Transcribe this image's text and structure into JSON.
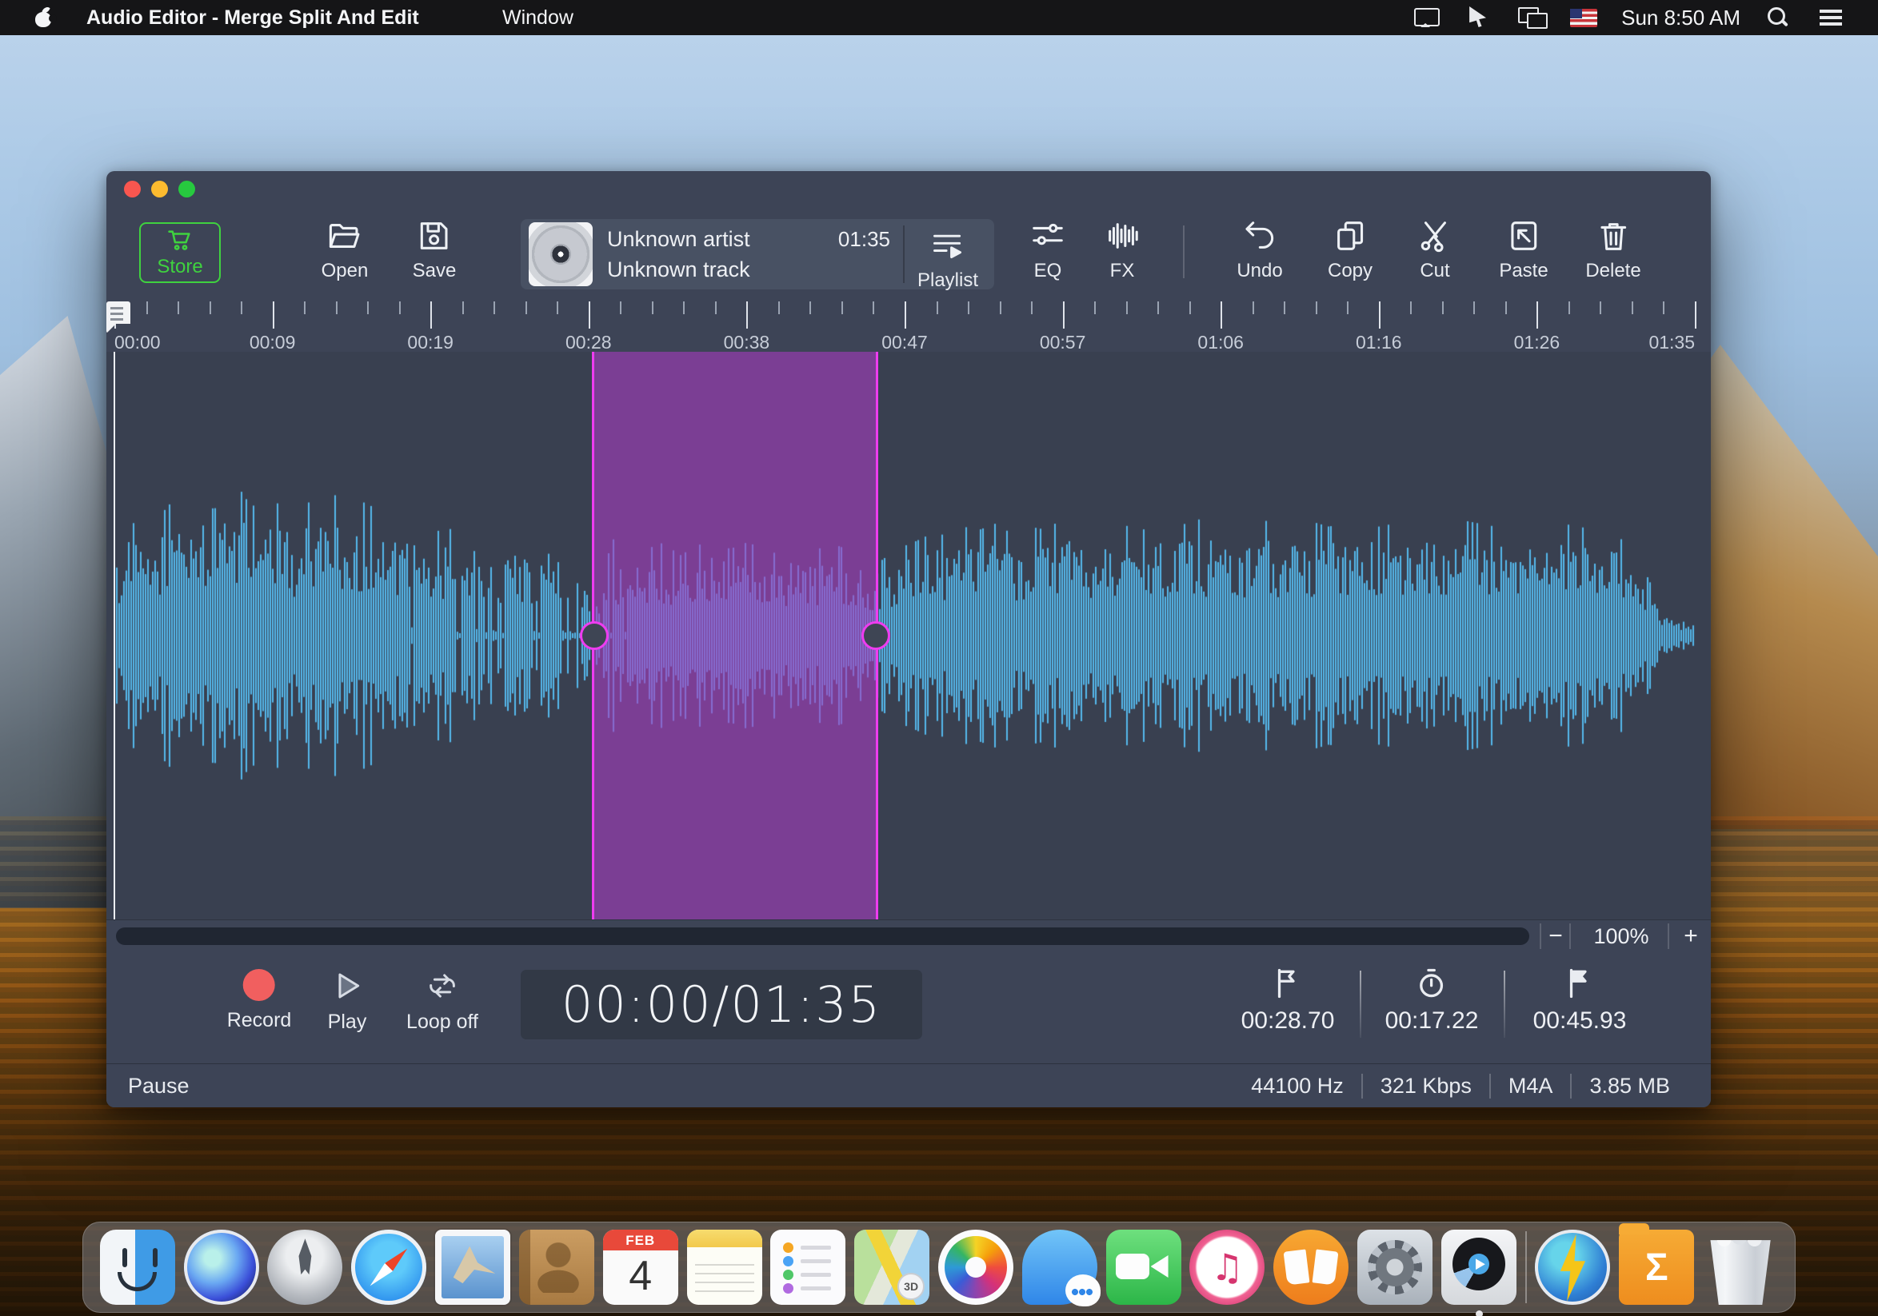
{
  "menu_bar": {
    "app_name": "Audio Editor - Merge Split And Edit",
    "menu": "Window",
    "clock": "Sun 8:50 AM"
  },
  "window": {
    "toolbar": {
      "store": "Store",
      "open": "Open",
      "save": "Save",
      "playlist": "Playlist",
      "eq": "EQ",
      "fx": "FX",
      "undo": "Undo",
      "copy": "Copy",
      "cut": "Cut",
      "paste": "Paste",
      "delete": "Delete"
    },
    "track": {
      "artist": "Unknown artist",
      "title": "Unknown track",
      "duration": "01:35"
    },
    "timeline": {
      "total_seconds": 95,
      "labels": [
        "00:00",
        "00:09",
        "00:19",
        "00:28",
        "00:38",
        "00:47",
        "00:57",
        "01:06",
        "01:16",
        "01:26",
        "01:35"
      ]
    },
    "waveform": {
      "color": "#55b8ec",
      "sparse_region": [
        17,
        31
      ],
      "envelope": [
        0.5,
        0.72,
        0.6,
        0.78,
        0.9,
        0.82,
        0.95,
        1.0,
        0.84,
        0.76,
        0.84,
        0.68,
        0.9,
        0.94,
        0.7,
        0.83,
        0.78,
        0.68,
        0.74,
        0.63,
        0.68,
        0.6,
        0.73,
        0.58,
        0.66,
        0.56,
        0.5,
        0.6,
        0.46,
        0.3,
        0.6,
        0.48,
        0.54,
        0.58,
        0.5,
        0.56,
        0.6,
        0.54,
        0.58,
        0.55,
        0.5,
        0.56,
        0.52,
        0.58,
        0.54,
        0.48,
        0.46,
        0.54,
        0.58,
        0.63,
        0.63,
        0.68,
        0.66,
        0.7,
        0.63,
        0.68,
        0.66,
        0.73,
        0.7,
        0.68,
        0.71,
        0.68,
        0.66,
        0.7,
        0.68,
        0.73,
        0.7,
        0.68,
        0.66,
        0.72,
        0.7,
        0.68,
        0.71,
        0.68,
        0.7,
        0.72,
        0.68,
        0.7,
        0.66,
        0.7,
        0.68,
        0.72,
        0.7,
        0.68,
        0.7,
        0.66,
        0.68,
        0.7,
        0.68,
        0.66,
        0.63,
        0.58,
        0.4,
        0.18,
        0.1,
        0.06
      ]
    },
    "selection": {
      "start_seconds": 28.7,
      "end_seconds": 45.93,
      "start_label": "00:28.70",
      "length_label": "00:17.22",
      "end_label": "00:45.93",
      "overlay_color": "rgba(165,62,190,0.62)",
      "border_color": "#ee3cf0"
    },
    "zoom": {
      "minus": "−",
      "level": "100%",
      "plus": "+"
    },
    "transport": {
      "record": "Record",
      "play": "Play",
      "loop": "Loop off",
      "time_display": "00:00/01:35"
    },
    "status": {
      "state": "Pause",
      "sample_rate": "44100 Hz",
      "bitrate": "321 Kbps",
      "format": "M4A",
      "size": "3.85 MB"
    }
  },
  "dock": {
    "calendar_month": "FEB",
    "calendar_day": "4",
    "maps_badge": "3D",
    "sigma": "Σ",
    "apps": [
      "Finder",
      "Siri",
      "Launchpad",
      "Safari",
      "Mail",
      "Contacts",
      "Calendar",
      "Notes",
      "Reminders",
      "Maps",
      "Photos",
      "Messages",
      "FaceTime",
      "iTunes",
      "iBooks",
      "System Preferences",
      "Audio Editor",
      "Lightning Utility",
      "Sigma Folder",
      "Trash"
    ]
  }
}
